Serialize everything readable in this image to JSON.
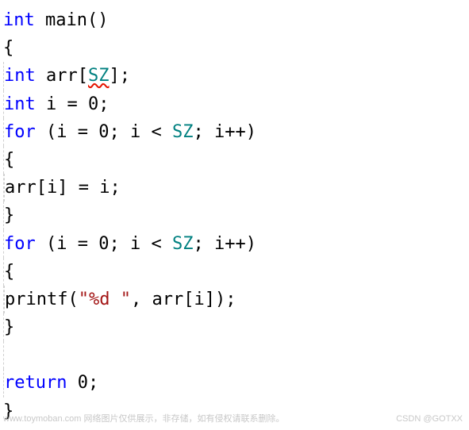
{
  "code": {
    "l1": {
      "kw_int": "int",
      "func": "main",
      "parens": "()"
    },
    "l2": {
      "brace": "{"
    },
    "l3": {
      "kw_int": "int",
      "id": "arr",
      "lbrack": "[",
      "sz": "SZ",
      "rbrack": "];"
    },
    "l4": {
      "kw_int": "int",
      "id": "i",
      "eq": " = ",
      "val": "0",
      "semi": ";"
    },
    "l5": {
      "kw_for": "for",
      "open": " (",
      "id1": "i",
      "eq1": " = ",
      "v1": "0",
      "sep1": "; ",
      "id2": "i",
      "lt": " < ",
      "sz": "SZ",
      "sep2": "; ",
      "id3": "i",
      "inc": "++)"
    },
    "l6": {
      "brace": "{"
    },
    "l7": {
      "id": "arr",
      "lbrack": "[",
      "idx": "i",
      "rbrack": "]",
      "eq": " = ",
      "val": "i",
      "semi": ";"
    },
    "l8": {
      "brace": "}"
    },
    "l9": {
      "kw_for": "for",
      "open": " (",
      "id1": "i",
      "eq1": " = ",
      "v1": "0",
      "sep1": "; ",
      "id2": "i",
      "lt": " < ",
      "sz": "SZ",
      "sep2": "; ",
      "id3": "i",
      "inc": "++)"
    },
    "l10": {
      "brace": "{"
    },
    "l11": {
      "func": "printf",
      "open": "(",
      "str": "\"%d \"",
      "comma": ", ",
      "id": "arr",
      "lbrack": "[",
      "idx": "i",
      "rbrack": "]);",
      "close": ""
    },
    "l12": {
      "brace": "}"
    },
    "l13_blank": "",
    "l14": {
      "kw_return": "return",
      "sp": " ",
      "val": "0",
      "semi": ";"
    },
    "l15": {
      "brace": "}"
    }
  },
  "watermarks": {
    "left": "www.toymoban.com 网络图片仅供展示，非存储，如有侵权请联系删除。",
    "right": "CSDN @GOTXX"
  }
}
